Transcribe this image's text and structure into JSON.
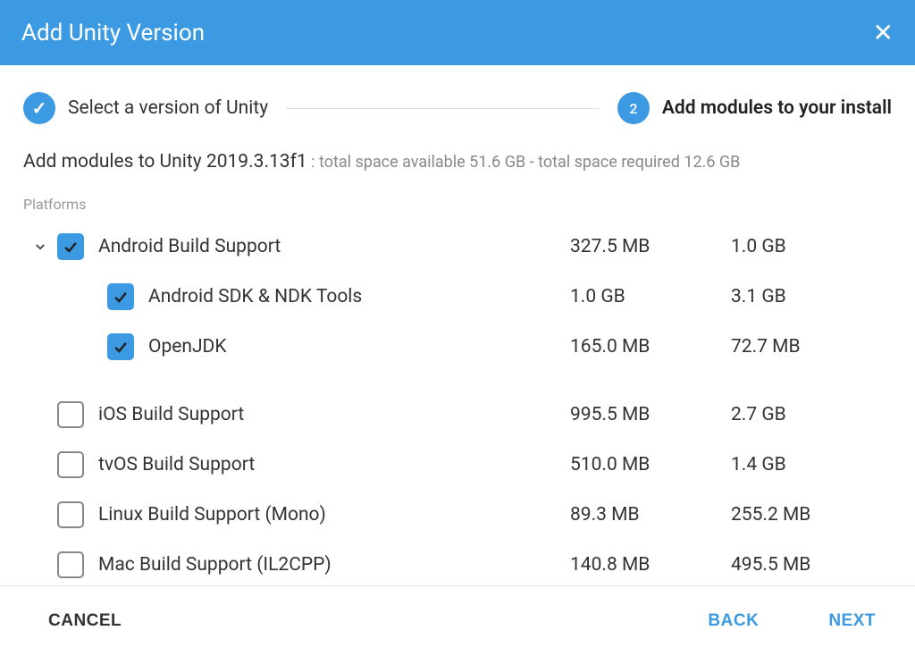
{
  "header": {
    "title": "Add Unity Version"
  },
  "stepper": {
    "step1_label": "Select a version of Unity",
    "step2_number": "2",
    "step2_label": "Add modules to your install"
  },
  "modules_header": {
    "prefix": "Add modules to Unity ",
    "version": "2019.3.13f1",
    "space_info": " : total space available 51.6 GB - total space required 12.6 GB"
  },
  "section_label": "Platforms",
  "modules": {
    "android": {
      "name": "Android Build Support",
      "download": "327.5 MB",
      "installed": "1.0 GB"
    },
    "android_sdk": {
      "name": "Android SDK & NDK Tools",
      "download": "1.0 GB",
      "installed": "3.1 GB"
    },
    "openjdk": {
      "name": "OpenJDK",
      "download": "165.0 MB",
      "installed": "72.7 MB"
    },
    "ios": {
      "name": "iOS Build Support",
      "download": "995.5 MB",
      "installed": "2.7 GB"
    },
    "tvos": {
      "name": "tvOS Build Support",
      "download": "510.0 MB",
      "installed": "1.4 GB"
    },
    "linux": {
      "name": "Linux Build Support (Mono)",
      "download": "89.3 MB",
      "installed": "255.2 MB"
    },
    "mac": {
      "name": "Mac Build Support (IL2CPP)",
      "download": "140.8 MB",
      "installed": "495.5 MB"
    }
  },
  "footer": {
    "cancel": "CANCEL",
    "back": "BACK",
    "next": "NEXT"
  }
}
